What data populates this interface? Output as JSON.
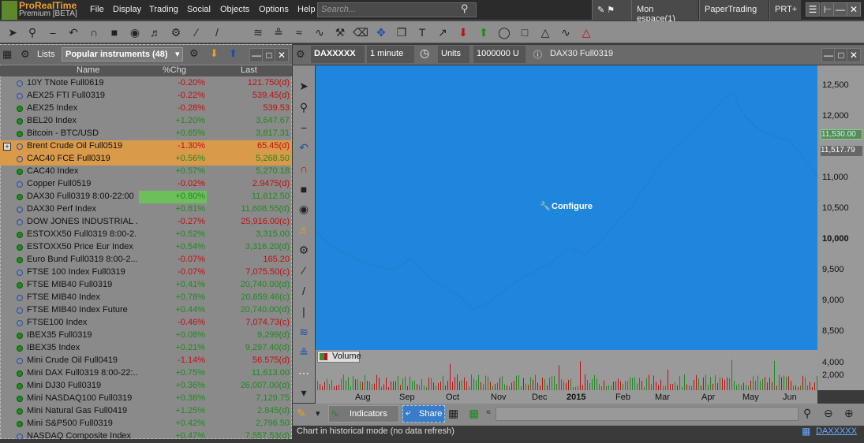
{
  "app": {
    "logo_line1": "ProRealTime",
    "logo_line2": "Premium [BETA]",
    "menu": [
      "File",
      "Display",
      "Trading",
      "Social",
      "Objects",
      "Options",
      "Help"
    ],
    "search_placeholder": "Search...",
    "workspace": "Mon espace(1)",
    "paper_trading": "PaperTrading",
    "prt": "PRT+"
  },
  "list_panel": {
    "lists_label": "Lists",
    "list_name": "Popular instruments (48)",
    "col_name": "Name",
    "col_chg": "%Chg",
    "col_last": "Last",
    "rows": [
      {
        "name": "10Y TNote Full0619",
        "chg": "-0.20%",
        "last": "121.750(d)",
        "dir": "neg",
        "dot": "hollow",
        "hl": ""
      },
      {
        "name": "AEX25 FTI Full0319",
        "chg": "-0.22%",
        "last": "539.45(d)",
        "dir": "neg",
        "dot": "hollow",
        "hl": ""
      },
      {
        "name": "AEX25 Index",
        "chg": "-0.28%",
        "last": "539.53",
        "dir": "neg",
        "dot": "green",
        "hl": ""
      },
      {
        "name": "BEL20 Index",
        "chg": "+1.20%",
        "last": "3,647.67",
        "dir": "pos",
        "dot": "green",
        "hl": ""
      },
      {
        "name": "Bitcoin - BTC/USD",
        "chg": "+0.65%",
        "last": "3,817.31",
        "dir": "pos",
        "dot": "green",
        "hl": ""
      },
      {
        "name": "Brent Crude Oil Full0519",
        "chg": "-1.30%",
        "last": "65.45(d)",
        "dir": "neg",
        "dot": "hollow",
        "hl": "orange"
      },
      {
        "name": "CAC40 FCE Full0319",
        "chg": "+0.56%",
        "last": "5,268.50",
        "dir": "pos",
        "dot": "hollow",
        "hl": "orange"
      },
      {
        "name": "CAC40 Index",
        "chg": "+0.57%",
        "last": "5,270.18",
        "dir": "pos",
        "dot": "green",
        "hl": ""
      },
      {
        "name": "Copper Full0519",
        "chg": "-0.02%",
        "last": "2.9475(d)",
        "dir": "neg",
        "dot": "hollow",
        "hl": ""
      },
      {
        "name": "DAX30 Full0319 8:00-22:00",
        "chg": "+0.80%",
        "last": "11,612.50",
        "dir": "pos",
        "dot": "green",
        "hl": "green"
      },
      {
        "name": "DAX30 Perf Index",
        "chg": "+0.81%",
        "last": "11,608.55(d)",
        "dir": "pos",
        "dot": "hollow",
        "hl": ""
      },
      {
        "name": "DOW JONES INDUSTRIAL ...",
        "chg": "-0.27%",
        "last": "25,916.00(c)",
        "dir": "neg",
        "dot": "hollow",
        "hl": ""
      },
      {
        "name": "ESTOXX50 Full0319 8:00-2...",
        "chg": "+0.52%",
        "last": "3,315.00",
        "dir": "pos",
        "dot": "green",
        "hl": ""
      },
      {
        "name": "ESTOXX50 Price Eur Index",
        "chg": "+0.54%",
        "last": "3,316.20(d)",
        "dir": "pos",
        "dot": "green",
        "hl": ""
      },
      {
        "name": "Euro Bund Full0319 8:00-2...",
        "chg": "-0.07%",
        "last": "165.20",
        "dir": "neg",
        "dot": "green",
        "hl": ""
      },
      {
        "name": "FTSE 100 Index Full0319",
        "chg": "-0.07%",
        "last": "7,075.50(c)",
        "dir": "neg",
        "dot": "hollow",
        "hl": ""
      },
      {
        "name": "FTSE MIB40 Full0319",
        "chg": "+0.41%",
        "last": "20,740.00(d)",
        "dir": "pos",
        "dot": "green",
        "hl": ""
      },
      {
        "name": "FTSE MIB40 Index",
        "chg": "+0.78%",
        "last": "20,659.46(c)",
        "dir": "pos",
        "dot": "hollow",
        "hl": ""
      },
      {
        "name": "FTSE MIB40 Index Future",
        "chg": "+0.44%",
        "last": "20,740.00(d)",
        "dir": "pos",
        "dot": "hollow",
        "hl": ""
      },
      {
        "name": "FTSE100 Index",
        "chg": "-0.46%",
        "last": "7,074.73(c)",
        "dir": "neg",
        "dot": "hollow",
        "hl": ""
      },
      {
        "name": "IBEX35 Full0319",
        "chg": "+0.08%",
        "last": "9,299(d)",
        "dir": "pos",
        "dot": "green",
        "hl": ""
      },
      {
        "name": "IBEX35 Index",
        "chg": "+0.21%",
        "last": "9,297.40(d)",
        "dir": "pos",
        "dot": "green",
        "hl": ""
      },
      {
        "name": "Mini Crude Oil Full0419",
        "chg": "-1.14%",
        "last": "56.575(d)",
        "dir": "neg",
        "dot": "hollow",
        "hl": ""
      },
      {
        "name": "Mini DAX Full0319 8:00-22:...",
        "chg": "+0.75%",
        "last": "11,613.00",
        "dir": "pos",
        "dot": "green",
        "hl": ""
      },
      {
        "name": "Mini DJ30 Full0319",
        "chg": "+0.36%",
        "last": "26,007.00(d)",
        "dir": "pos",
        "dot": "green",
        "hl": ""
      },
      {
        "name": "Mini NASDAQ100 Full0319",
        "chg": "+0.38%",
        "last": "7,129.75",
        "dir": "pos",
        "dot": "green",
        "hl": ""
      },
      {
        "name": "Mini Natural Gas Full0419",
        "chg": "+1.25%",
        "last": "2.845(d)",
        "dir": "pos",
        "dot": "green",
        "hl": ""
      },
      {
        "name": "Mini S&P500 Full0319",
        "chg": "+0.42%",
        "last": "2,796.50",
        "dir": "pos",
        "dot": "green",
        "hl": ""
      },
      {
        "name": "NASDAQ Composite Index",
        "chg": "+0.47%",
        "last": "7,557.53(d)",
        "dir": "pos",
        "dot": "hollow",
        "hl": ""
      }
    ]
  },
  "chart_panel": {
    "instrument": "DAXXXXX",
    "timeframe": "1 minute",
    "units": "Units",
    "units_value": "1000000 U",
    "title": "DAX30 Full0319",
    "configure": "Configure",
    "volume_label": "Volume",
    "y_ticks": [
      "12,500",
      "12,000",
      "11,000",
      "10,500",
      "10,000",
      "9,500",
      "9,000",
      "8,500"
    ],
    "price_label_1": "11,530.00",
    "price_label_2": "11,517.79",
    "vol_ticks": [
      "4,000",
      "2,000"
    ],
    "x_ticks": [
      "Aug",
      "Sep",
      "Oct",
      "Nov",
      "Dec",
      "2015",
      "Feb",
      "Mar",
      "Apr",
      "May",
      "Jun"
    ],
    "indicators": "Indicators",
    "share": "Share",
    "status": "Chart in historical mode (no data refresh)",
    "status_link": "DAXXXXX"
  },
  "colors": {
    "chart_blue": "#1e86dc",
    "positive": "#1f8a1f",
    "negative": "#c01010",
    "highlight_orange": "#d99a4a",
    "highlight_green": "#6cbf5a"
  }
}
